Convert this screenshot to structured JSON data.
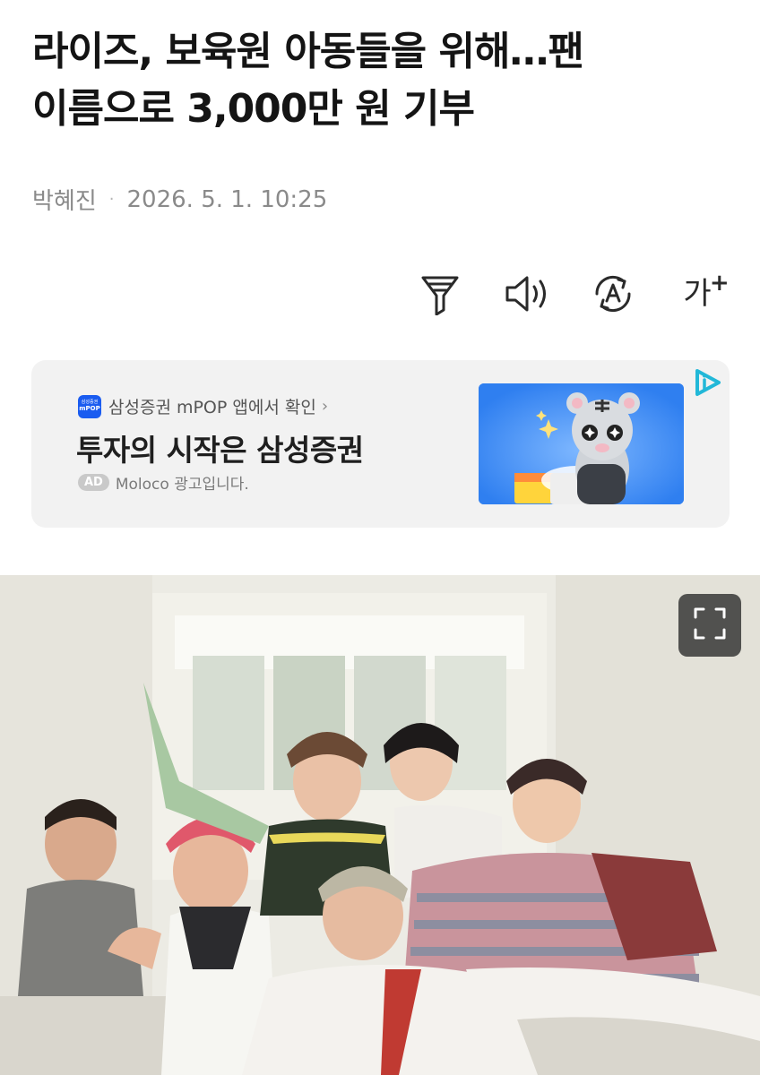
{
  "article": {
    "headline_line1": "라이즈, 보육원 아동들을 위해…팬",
    "headline_line2": "이름으로 3,000만 원 기부",
    "author": "박혜진",
    "separator": "·",
    "datetime": "2026. 5. 1. 10:25"
  },
  "toolbar": {
    "items": [
      {
        "name": "filter-icon"
      },
      {
        "name": "speaker-icon"
      },
      {
        "name": "translate-icon"
      },
      {
        "name": "font-size-icon",
        "label": "가",
        "plus": "+"
      }
    ]
  },
  "ad": {
    "source_logo_top": "삼성증권",
    "source_logo_bottom": "mPOP",
    "source_text": "삼성증권 mPOP 앱에서 확인",
    "chevron": "›",
    "headline": "투자의 시작은 삼성증권",
    "badge": "AD",
    "advertiser": "Moloco 광고입니다.",
    "colors": {
      "logo": "#1a5cf0",
      "thumb_bg": "#2f7ff0",
      "corner_icon": "#22b8d8"
    }
  },
  "photo": {
    "expand_icon": "expand-icon"
  }
}
